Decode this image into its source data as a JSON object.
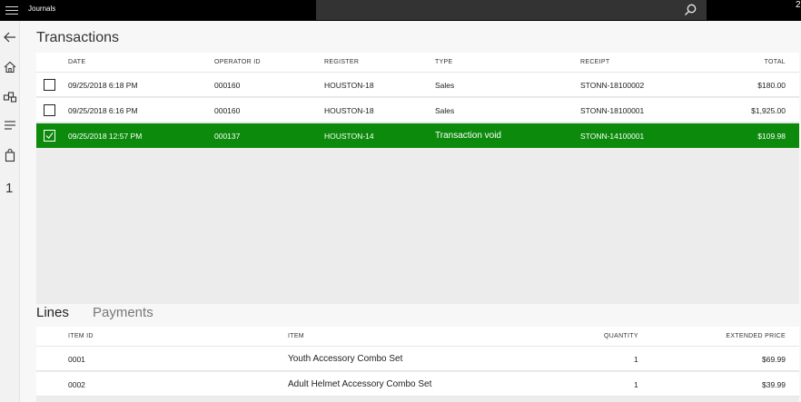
{
  "app": {
    "title": "Journals",
    "search_placeholder": "",
    "corner_glyph": "2",
    "accent_color": "#0c8a0c"
  },
  "rail": {
    "icons": [
      "back-icon",
      "home-icon",
      "products-icon",
      "menu-list-icon",
      "shopping-bag-icon"
    ],
    "badge": "1"
  },
  "transactions": {
    "title": "Transactions",
    "columns": {
      "date": "DATE",
      "operator": "OPERATOR ID",
      "register": "REGISTER",
      "type": "TYPE",
      "receipt": "RECEIPT",
      "total": "TOTAL"
    },
    "rows": [
      {
        "date": "09/25/2018 6:18 PM",
        "operator": "000160",
        "register": "HOUSTON-18",
        "type": "Sales",
        "receipt": "STONN-18100002",
        "total": "$180.00",
        "selected": false
      },
      {
        "date": "09/25/2018 6:16 PM",
        "operator": "000160",
        "register": "HOUSTON-18",
        "type": "Sales",
        "receipt": "STONN-18100001",
        "total": "$1,925.00",
        "selected": false
      },
      {
        "date": "09/25/2018 12:57 PM",
        "operator": "000137",
        "register": "HOUSTON-14",
        "type": "Transaction void",
        "receipt": "STONN-14100001",
        "total": "$109.98",
        "selected": true
      }
    ]
  },
  "tabs": {
    "lines": "Lines",
    "payments": "Payments"
  },
  "lines": {
    "columns": {
      "item_id": "ITEM ID",
      "item": "ITEM",
      "quantity": "QUANTITY",
      "price": "EXTENDED PRICE"
    },
    "rows": [
      {
        "item_id": "0001",
        "item": "Youth Accessory Combo Set",
        "quantity": "1",
        "price": "$69.99"
      },
      {
        "item_id": "0002",
        "item": "Adult Helmet Accessory Combo Set",
        "quantity": "1",
        "price": "$39.99"
      }
    ]
  }
}
